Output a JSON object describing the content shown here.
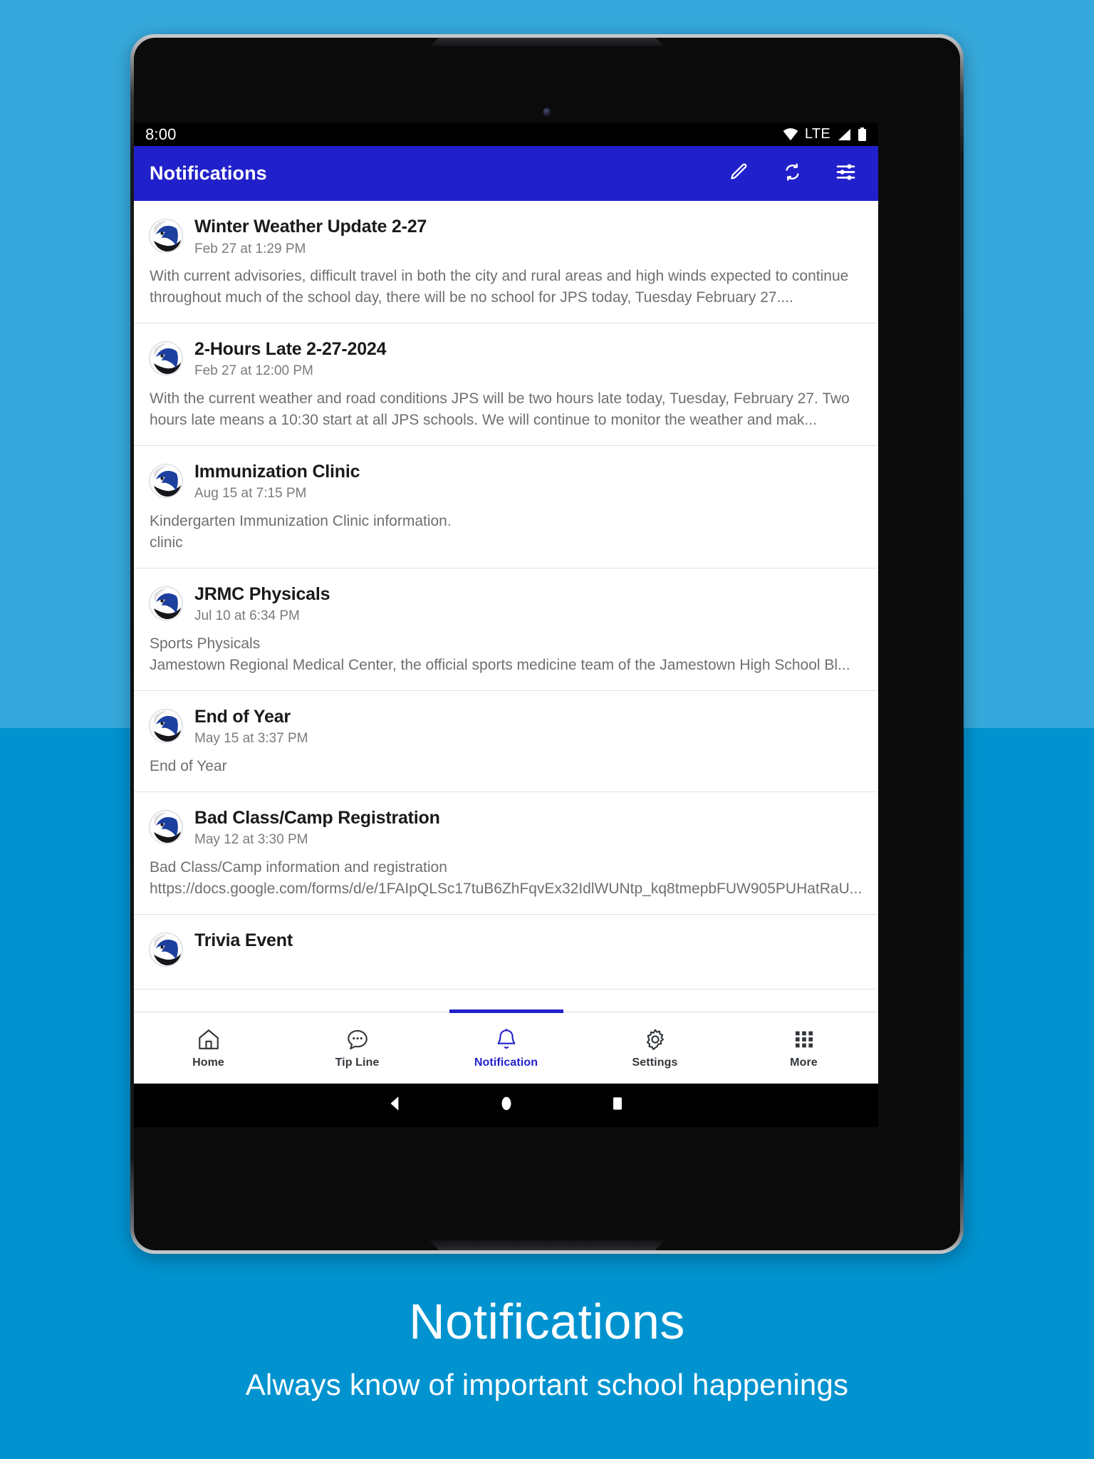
{
  "background": {
    "top_color": "#36a9dc",
    "bottom_color": "#0093d0"
  },
  "status_bar": {
    "time": "8:00",
    "network_label": "LTE",
    "icons": [
      "wifi-icon",
      "lte-label",
      "signal-icon",
      "battery-icon"
    ]
  },
  "app_bar": {
    "title": "Notifications",
    "accent_color": "#2121cb",
    "actions": [
      {
        "name": "edit-icon",
        "label": "Edit"
      },
      {
        "name": "refresh-icon",
        "label": "Refresh"
      },
      {
        "name": "filter-icon",
        "label": "Filter"
      }
    ]
  },
  "notifications": [
    {
      "title": "Winter Weather Update 2-27",
      "date": "Feb 27 at 1:29 PM",
      "body": "With current advisories, difficult travel in both the city and rural areas and high winds expected to continue throughout much of the school day, there will be no school for JPS today, Tuesday February 27...."
    },
    {
      "title": "2-Hours Late 2-27-2024",
      "date": "Feb 27 at 12:00 PM",
      "body": "With the current weather and road conditions JPS will be two hours late today, Tuesday, February 27. Two hours late means a 10:30 start at all JPS schools.  We will continue to monitor the weather and mak..."
    },
    {
      "title": "Immunization Clinic",
      "date": "Aug 15 at 7:15 PM",
      "body": "Kindergarten Immunization Clinic information.\nclinic"
    },
    {
      "title": "JRMC Physicals",
      "date": "Jul 10 at 6:34 PM",
      "body": "Sports Physicals\nJamestown Regional Medical Center, the official sports medicine team of the Jamestown High School Bl..."
    },
    {
      "title": "End of Year",
      "date": "May 15 at 3:37 PM",
      "body": "End of Year"
    },
    {
      "title": "Bad Class/Camp Registration",
      "date": "May 12 at 3:30 PM",
      "body": "Bad Class/Camp information and registration\nhttps://docs.google.com/forms/d/e/1FAIpQLSc17tuB6ZhFqvEx32IdlWUNtp_kq8tmepbFUW905PUHatRaU..."
    },
    {
      "title": "Trivia Event",
      "date": "",
      "body": ""
    }
  ],
  "bottom_nav": {
    "active_index": 2,
    "items": [
      {
        "label": "Home",
        "icon": "home-icon"
      },
      {
        "label": "Tip Line",
        "icon": "chat-bubble-icon"
      },
      {
        "label": "Notification",
        "icon": "bell-icon"
      },
      {
        "label": "Settings",
        "icon": "gear-icon"
      },
      {
        "label": "More",
        "icon": "grid-icon"
      }
    ]
  },
  "system_nav": {
    "buttons": [
      {
        "name": "back-button"
      },
      {
        "name": "home-button"
      },
      {
        "name": "recents-button"
      }
    ]
  },
  "caption": {
    "title": "Notifications",
    "subtitle": "Always know of important school happenings"
  }
}
